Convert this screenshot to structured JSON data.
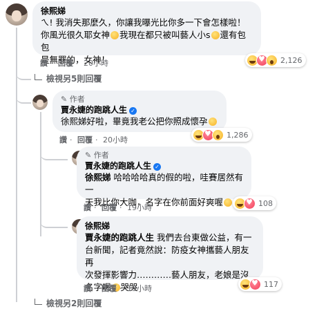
{
  "comments": {
    "c1": {
      "author": "徐熙娣",
      "line1": "ㄟ! 我消失那麼久，你讓我曝光比你多一下會怎樣啦！",
      "line2a": "你風光很久耶女神",
      "line2b": "我現在都只被叫藝人小s",
      "line2c": "還有包包",
      "line3": "是無罪的，女神！",
      "reactions": "2,126",
      "actions": {
        "like": "讚",
        "reply": "回覆",
        "time": "20小時"
      }
    },
    "view_more": "檢視另5則回覆",
    "r1": {
      "author_badge": "作者",
      "author": "賈永婕的跑跳人生",
      "text": "徐熙娣好啦，畢竟我老公把你照成懷孕",
      "reactions": "1,286",
      "actions": {
        "like": "讚",
        "reply": "回覆",
        "time": "20小時"
      }
    },
    "r2": {
      "author_badge": "作者",
      "author": "賈永婕的跑跳人生",
      "tag": "徐熙娣",
      "line1": "哈哈哈哈真的假的啦，哇賽居然有一",
      "line2": "天我比你大咖，名字在你前面好爽喔",
      "reactions": "108",
      "actions": {
        "like": "讚",
        "reply": "回覆",
        "time": "19小時"
      }
    },
    "r3": {
      "author": "徐熙娣",
      "tag": "賈永婕的跑跳人生",
      "line1": "我們去台東做公益，有一",
      "line2": "台新聞，記者竟然說：防疫女神攜藝人朋友再",
      "line3": "次發揮影響力‥‥‥‥‥‥藝人朋友，老娘是沒",
      "line4": "名字喔",
      "line4b": "哭哭",
      "reactions": "117",
      "actions": {
        "like": "讚",
        "reply": "回覆",
        "time": "19小時"
      }
    },
    "bottom_partial": "檢視另2則回覆"
  }
}
